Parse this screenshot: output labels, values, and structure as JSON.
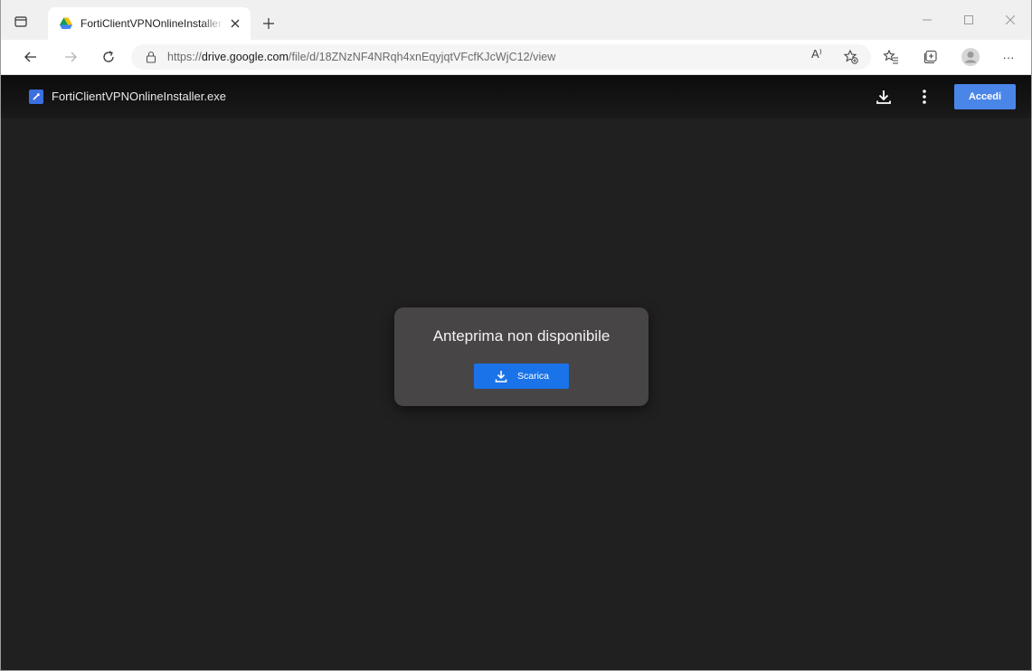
{
  "browser": {
    "tab": {
      "title": "FortiClientVPNOnlineInstaller.exe"
    },
    "address": {
      "scheme": "https://",
      "host": "drive.google.com",
      "path": "/file/d/18ZNzNF4NRqh4xnEqyjqtVFcfKJcWjC12/view"
    },
    "read_aloud_label": "A⁾",
    "more_label": "···"
  },
  "viewer": {
    "file_name": "FortiClientVPNOnlineInstaller.exe",
    "signin_label": "Accedi",
    "no_preview_text": "Anteprima non disponibile",
    "download_label": "Scarica"
  },
  "colors": {
    "viewer_bg": "#202020",
    "accent_blue": "#1a73e8",
    "signin_blue": "#4a86e8",
    "dialog_bg": "#484547"
  },
  "icons": {
    "tab_actions": "tab-actions-icon",
    "favicon": "google-drive-icon",
    "close_tab": "close-icon",
    "new_tab": "plus-icon",
    "back": "back-arrow-icon",
    "forward": "forward-arrow-icon",
    "refresh": "refresh-icon",
    "lock": "lock-icon",
    "favorite_add": "add-favorite-icon",
    "favorites": "favorites-icon",
    "collections": "collections-icon",
    "profile": "profile-icon",
    "download": "download-icon",
    "more": "more-vert-icon"
  }
}
